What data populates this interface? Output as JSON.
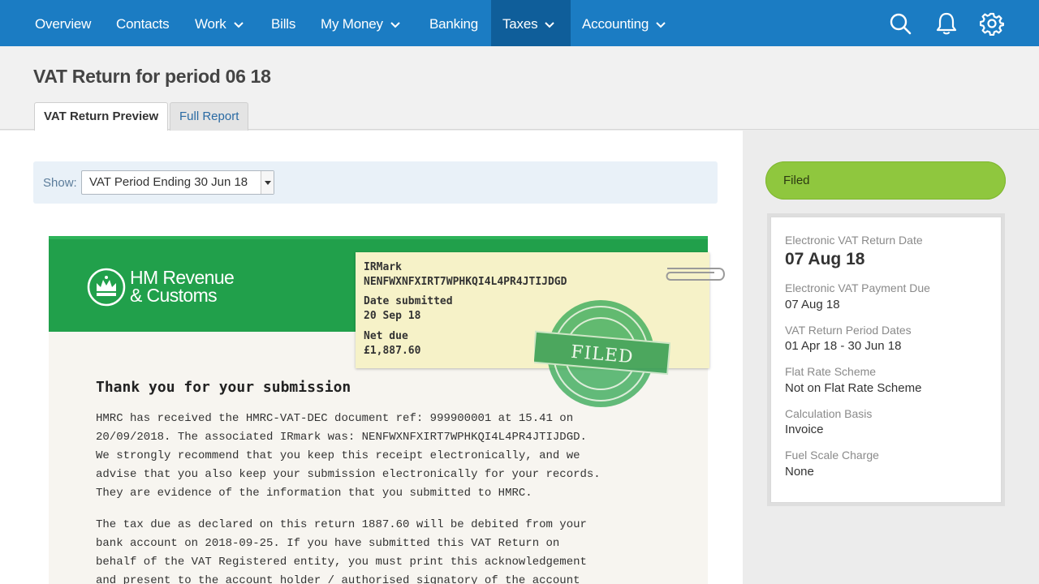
{
  "nav": {
    "items": [
      {
        "label": "Overview",
        "dropdown": false
      },
      {
        "label": "Contacts",
        "dropdown": false
      },
      {
        "label": "Work",
        "dropdown": true
      },
      {
        "label": "Bills",
        "dropdown": false
      },
      {
        "label": "My Money",
        "dropdown": true
      },
      {
        "label": "Banking",
        "dropdown": false
      },
      {
        "label": "Taxes",
        "dropdown": true,
        "active": true
      },
      {
        "label": "Accounting",
        "dropdown": true
      }
    ],
    "icons": [
      "search-icon",
      "bell-icon",
      "gear-icon"
    ],
    "colors": {
      "bar": "#1b7cc3",
      "active": "#0f5e9a"
    }
  },
  "page": {
    "title": "VAT Return for period 06 18",
    "tabs": [
      {
        "label": "VAT Return Preview",
        "active": true
      },
      {
        "label": "Full Report",
        "active": false
      }
    ]
  },
  "filter": {
    "label": "Show:",
    "selected": "VAT Period Ending 30 Jun 18"
  },
  "receipt": {
    "logo_text": [
      "HM Revenue",
      "& Customs"
    ],
    "irmark_label": "IRMark",
    "irmark_value": "NENFWXNFXIRT7WPHKQI4L4PR4JTIJDGD",
    "date_label": "Date submitted",
    "date_value": "20 Sep 18",
    "net_label": "Net due",
    "net_value": "£1,887.60",
    "stamp_text": "FILED",
    "heading": "Thank you for your submission",
    "paragraph1": [
      "HMRC has received the HMRC-VAT-DEC document ref: 999900001 at 15.41 on",
      "20/09/2018. The associated IRmark was: NENFWXNFXIRT7WPHKQI4L4PR4JTIJDGD.",
      "We strongly recommend that you keep this receipt electronically, and we",
      "advise that you also keep your submission electronically for your records.",
      "They are evidence of the information that you submitted to HMRC."
    ],
    "paragraph2": [
      "The tax due as declared on this return 1887.60 will be debited from your",
      "bank account on 2018-09-25. If you have submitted this VAT Return on",
      "behalf of the VAT Registered entity, you must print this acknowledgement",
      "and present to the account holder / authorised signatory of the account"
    ],
    "colors": {
      "band": "#21a04b",
      "note": "#f6f2c8"
    }
  },
  "sidebar": {
    "status": "Filed",
    "status_color": "#8fc73e",
    "fields": [
      {
        "label": "Electronic VAT Return Date",
        "value": "07 Aug 18"
      },
      {
        "label": "Electronic VAT Payment Due",
        "value": "07 Aug 18"
      },
      {
        "label": "VAT Return Period Dates",
        "value": "01 Apr 18 - 30 Jun 18"
      },
      {
        "label": "Flat Rate Scheme",
        "value": "Not on Flat Rate Scheme"
      },
      {
        "label": "Calculation Basis",
        "value": "Invoice"
      },
      {
        "label": "Fuel Scale Charge",
        "value": "None"
      }
    ]
  }
}
